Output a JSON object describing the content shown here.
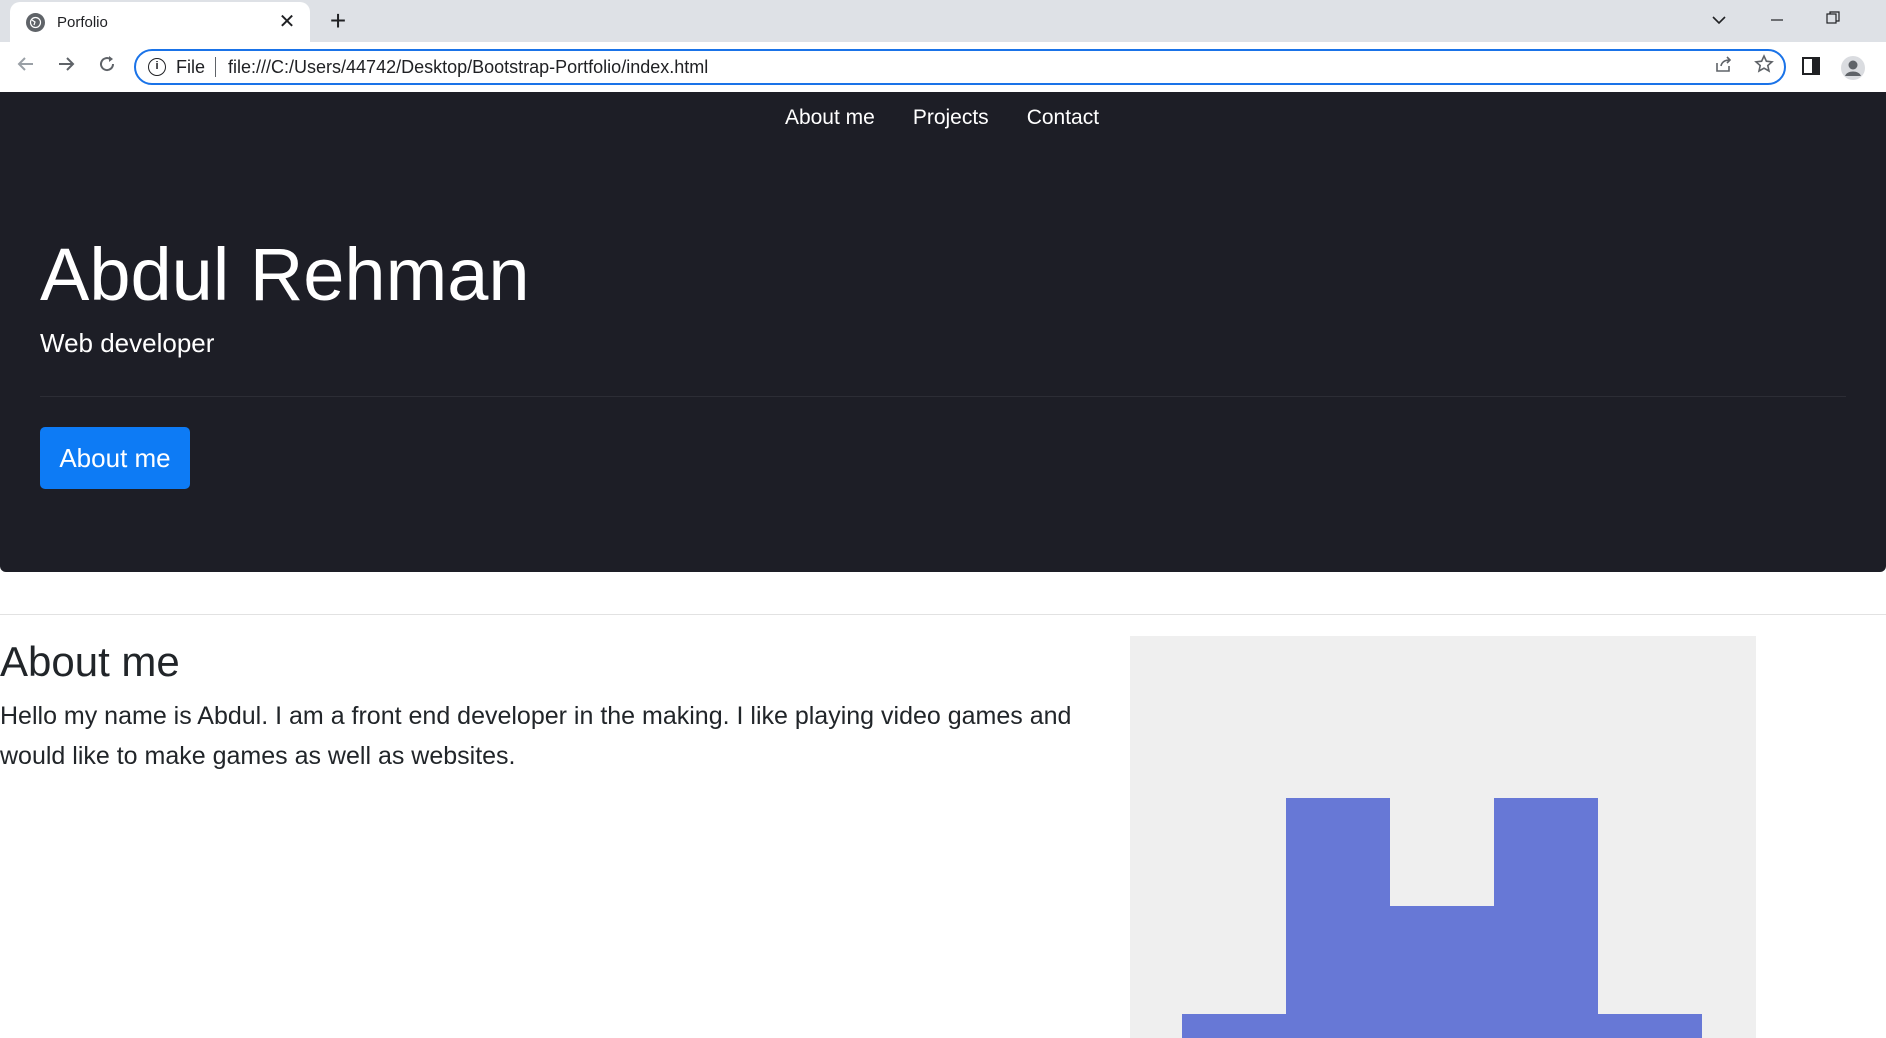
{
  "browser": {
    "tab_title": "Porfolio",
    "address_scheme": "File",
    "url": "file:///C:/Users/44742/Desktop/Bootstrap-Portfolio/index.html"
  },
  "nav": {
    "items": [
      "About me",
      "Projects",
      "Contact"
    ]
  },
  "hero": {
    "name": "Abdul Rehman",
    "role": "Web developer",
    "button_label": "About me"
  },
  "about": {
    "heading": "About me",
    "text": "Hello my name is Abdul. I am a front end developer in the making. I like playing video games and would like to make games as well as websites."
  },
  "colors": {
    "hero_bg": "#1d1e26",
    "primary_button": "#0d7bf5",
    "avatar_bg": "#efefef",
    "avatar_fill": "#6778d6"
  },
  "icons": [
    "globe-icon",
    "close-icon",
    "plus-icon",
    "chevron-down-icon",
    "minimize-icon",
    "restore-icon",
    "back-icon",
    "forward-icon",
    "reload-icon",
    "info-icon",
    "share-icon",
    "star-icon",
    "side-panel-icon",
    "profile-icon"
  ]
}
